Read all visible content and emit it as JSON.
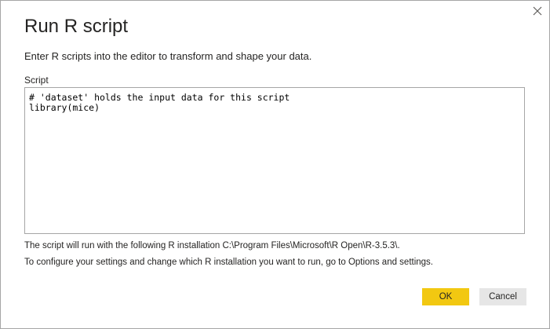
{
  "dialog": {
    "title": "Run R script",
    "subtitle": "Enter R scripts into the editor to transform and shape your data.",
    "close_icon": "close-icon"
  },
  "script_field": {
    "label": "Script",
    "value": "# 'dataset' holds the input data for this script\nlibrary(mice)"
  },
  "info": {
    "installation": "The script will run with the following R installation C:\\Program Files\\Microsoft\\R Open\\R-3.5.3\\.",
    "configure": "To configure your settings and change which R installation you want to run, go to Options and settings."
  },
  "buttons": {
    "ok_label": "OK",
    "cancel_label": "Cancel"
  },
  "colors": {
    "accent": "#f2c811",
    "secondary_button": "#e6e6e6",
    "border": "#a6a6a6",
    "text": "#252423"
  }
}
